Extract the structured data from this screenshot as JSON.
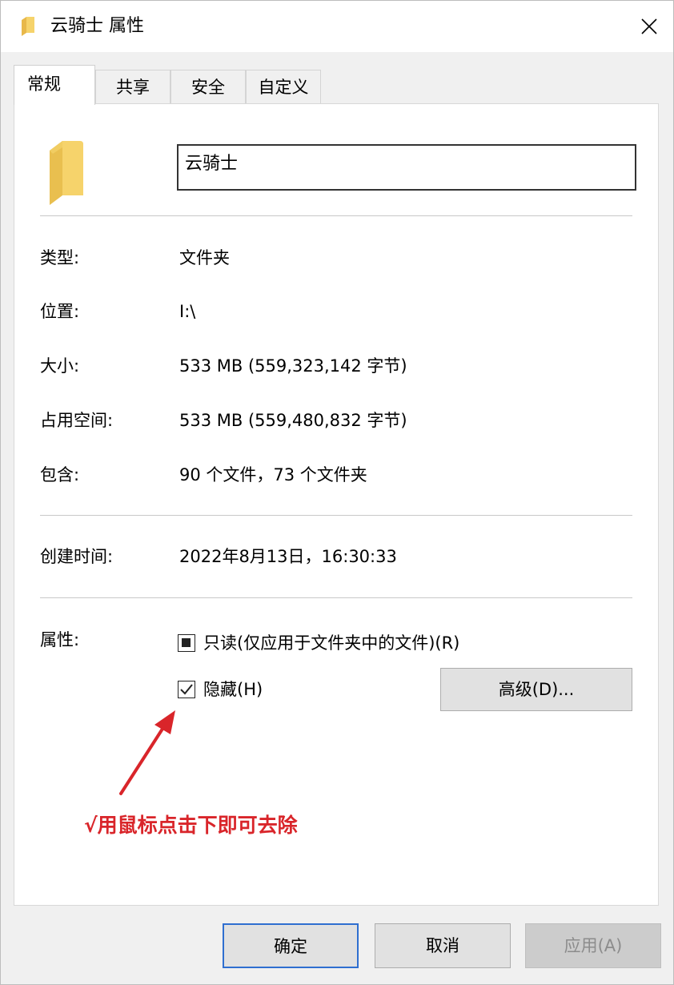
{
  "window": {
    "title": "云骑士 属性",
    "close_symbol": "✕"
  },
  "tabs": [
    {
      "label": "常规",
      "active": true
    },
    {
      "label": "共享",
      "active": false
    },
    {
      "label": "安全",
      "active": false
    },
    {
      "label": "自定义",
      "active": false
    }
  ],
  "general": {
    "folder_name": "云骑士",
    "rows": [
      {
        "label": "类型:",
        "value": "文件夹"
      },
      {
        "label": "位置:",
        "value": "I:\\"
      },
      {
        "label": "大小:",
        "value": "533 MB (559,323,142 字节)"
      },
      {
        "label": "占用空间:",
        "value": "533 MB (559,480,832 字节)"
      },
      {
        "label": "包含:",
        "value": "90 个文件，73 个文件夹"
      }
    ],
    "created": {
      "label": "创建时间:",
      "value": "2022年8月13日，16:30:33"
    },
    "attributes": {
      "label": "属性:",
      "readonly_label": "只读(仅应用于文件夹中的文件)(R)",
      "readonly_state": "indeterminate",
      "hidden_label": "隐藏(H)",
      "hidden_checked": true,
      "advanced_button": "高级(D)..."
    }
  },
  "annotation": {
    "text": "√用鼠标点击下即可去除",
    "color": "#d9252a"
  },
  "footer": {
    "ok": "确定",
    "cancel": "取消",
    "apply": "应用(A)"
  },
  "colors": {
    "folder_yellow": "#f6d36b",
    "panel_bg": "#ffffff",
    "window_bg": "#f0f0f0",
    "ok_border": "#2f6fd0"
  }
}
